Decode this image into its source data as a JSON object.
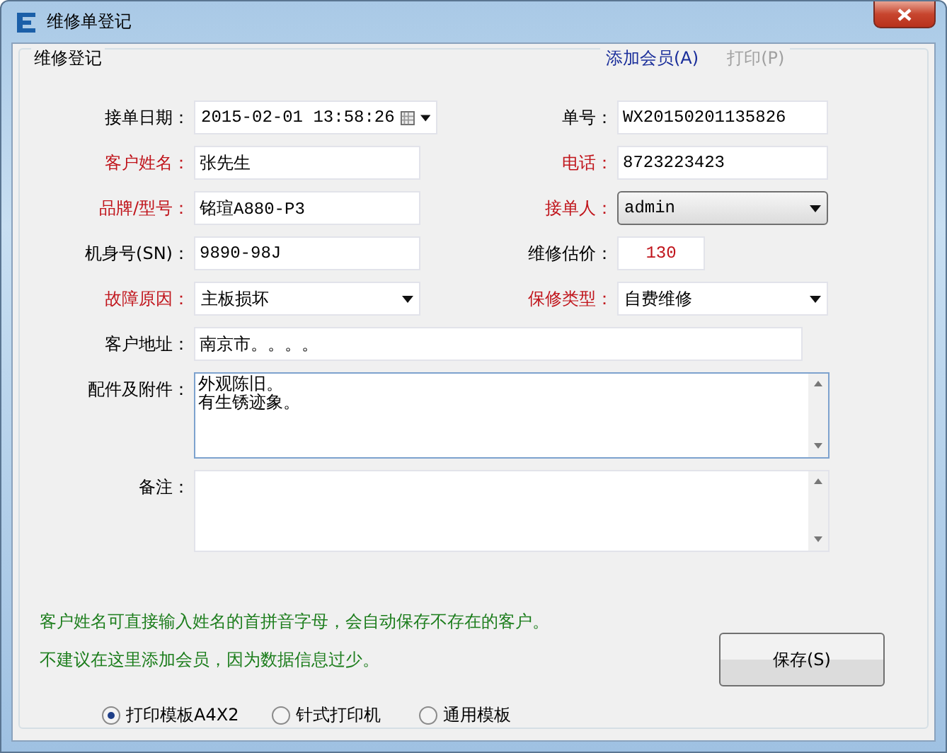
{
  "window": {
    "title": "维修单登记"
  },
  "group": {
    "title": "维修登记"
  },
  "links": [
    {
      "label": "添加会员(A)",
      "disabled": false
    },
    {
      "label": "打印(P)",
      "disabled": true
    }
  ],
  "fields": [
    {
      "label": "接单日期：",
      "value": "2015-02-01 13:58:26",
      "kind": "datetime",
      "required": false
    },
    {
      "label": "单号：",
      "value": "WX20150201135826",
      "kind": "text",
      "required": false
    },
    {
      "label": "客户姓名：",
      "value": "张先生",
      "kind": "text",
      "required": true
    },
    {
      "label": "电话：",
      "value": "8723223423",
      "kind": "text",
      "required": true
    },
    {
      "label": "品牌/型号：",
      "value": "铭瑄A880-P3",
      "kind": "text",
      "required": true
    },
    {
      "label": "接单人：",
      "value": "admin",
      "kind": "button-select",
      "required": true
    },
    {
      "label": "机身号(SN)：",
      "value": "9890-98J",
      "kind": "text",
      "required": false
    },
    {
      "label": "维修估价：",
      "value": "130",
      "kind": "price",
      "required": false
    },
    {
      "label": "故障原因：",
      "value": "主板损坏",
      "kind": "select",
      "required": true
    },
    {
      "label": "保修类型：",
      "value": "自费维修",
      "kind": "select",
      "required": true
    },
    {
      "label": "客户地址：",
      "value": "南京市。。。。",
      "kind": "wide",
      "required": false
    },
    {
      "label": "配件及附件：",
      "lines": [
        "外观陈旧。",
        "有生锈迹象。"
      ],
      "kind": "textarea",
      "required": false
    },
    {
      "label": "备注：",
      "kind": "textarea",
      "required": false
    }
  ],
  "notes": [
    "客户姓名可直接输入姓名的首拼音字母，会自动保存不存在的客户。",
    "不建议在这里添加会员，因为数据信息过少。"
  ],
  "save_button": "保存(S)",
  "templates": [
    {
      "label": "打印模板A4X2",
      "selected": true
    },
    {
      "label": "针式打印机",
      "selected": false
    },
    {
      "label": "通用模板",
      "selected": false
    }
  ]
}
